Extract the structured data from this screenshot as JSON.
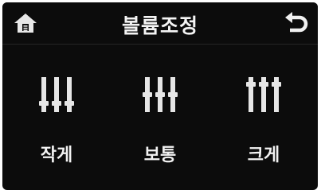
{
  "header": {
    "title": "볼륨조정",
    "home_icon": "home-icon",
    "back_icon": "back-arrow-icon"
  },
  "options": [
    {
      "label": "작게",
      "icon": "volume-low-icon",
      "level": "low"
    },
    {
      "label": "보통",
      "icon": "volume-medium-icon",
      "level": "medium"
    },
    {
      "label": "크게",
      "icon": "volume-high-icon",
      "level": "high"
    }
  ],
  "colors": {
    "background": "#0c0c0c",
    "text": "#f4f4f4",
    "icon": "#e6e6e6"
  }
}
